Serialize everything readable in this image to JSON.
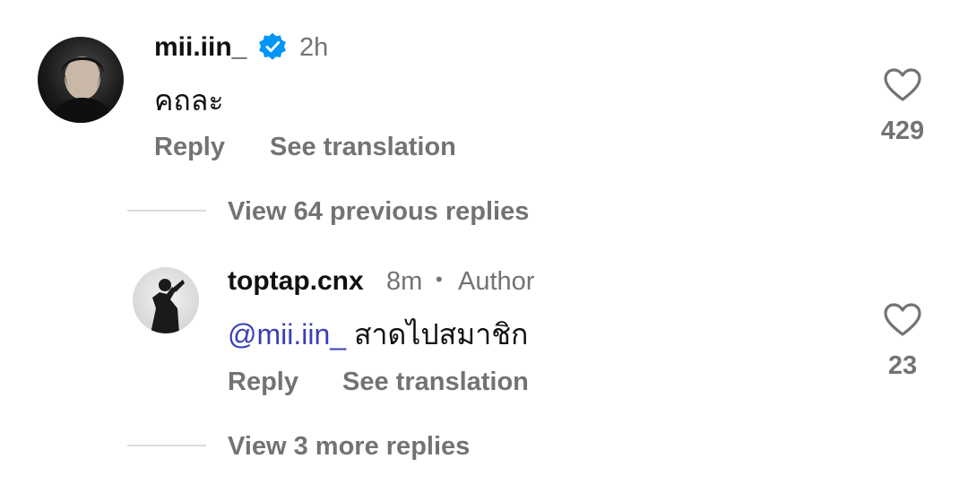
{
  "comment": {
    "username": "mii.iin_",
    "verified": true,
    "time": "2h",
    "text": "คถละ",
    "reply_label": "Reply",
    "translate_label": "See translation",
    "likes": "429"
  },
  "view_previous": "View 64 previous replies",
  "reply": {
    "username": "toptap.cnx",
    "time": "8m",
    "separator": "•",
    "badge": "Author",
    "mention": "@mii.iin_",
    "text": " สาดไปสมาชิก",
    "reply_label": "Reply",
    "translate_label": "See translation",
    "likes": "23"
  },
  "view_more": "View 3 more replies",
  "icons": {
    "verified": "verified-badge-icon",
    "like": "heart-outline-icon"
  },
  "colors": {
    "muted": "#737373",
    "mention": "#3a3fb5",
    "verified": "#0095f6"
  }
}
